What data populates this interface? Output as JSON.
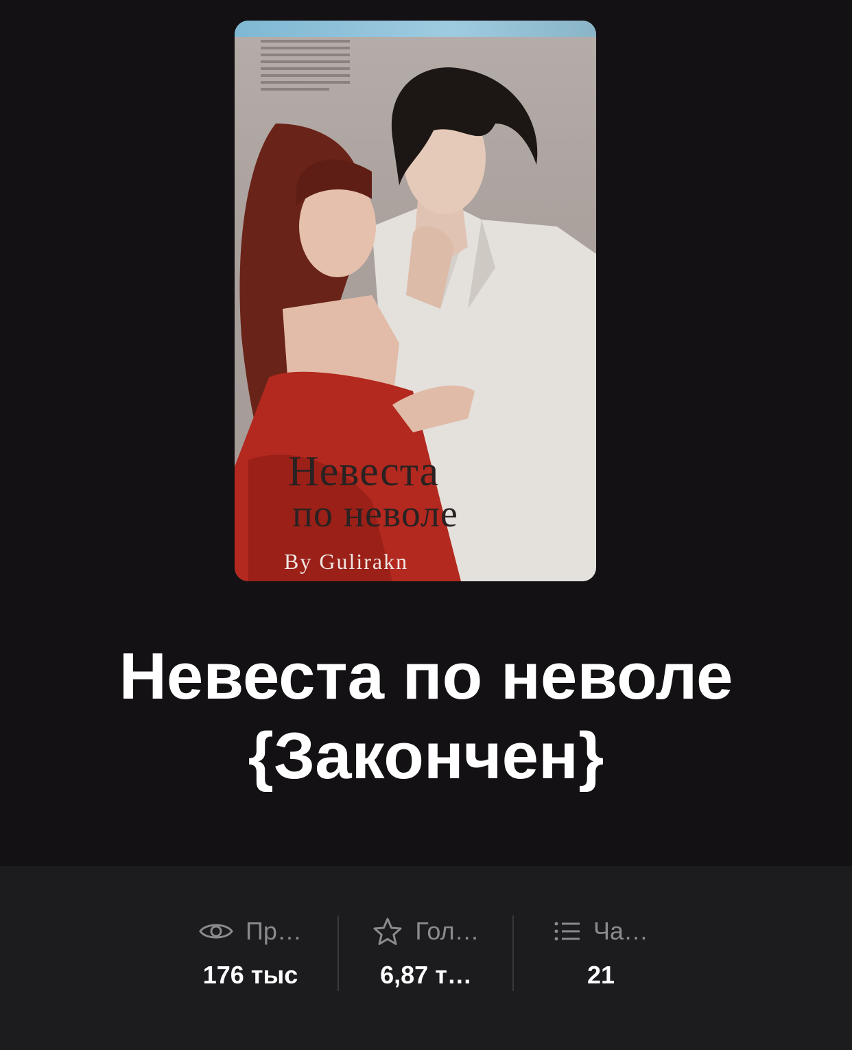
{
  "cover": {
    "title_line1": "Невеста",
    "title_line2": "по неволе",
    "author": "By Gulirakn"
  },
  "story": {
    "title": "Невеста по неволе {Закончен}"
  },
  "stats": [
    {
      "icon": "eye-icon",
      "label": "Пр…",
      "value": "176 тыс"
    },
    {
      "icon": "star-icon",
      "label": "Гол…",
      "value": "6,87 т…"
    },
    {
      "icon": "list-icon",
      "label": "Ча…",
      "value": "21"
    }
  ],
  "colors": {
    "background": "#131114",
    "stats_background": "#1c1b1e",
    "label": "#8c8a8f",
    "value": "#ffffff"
  }
}
